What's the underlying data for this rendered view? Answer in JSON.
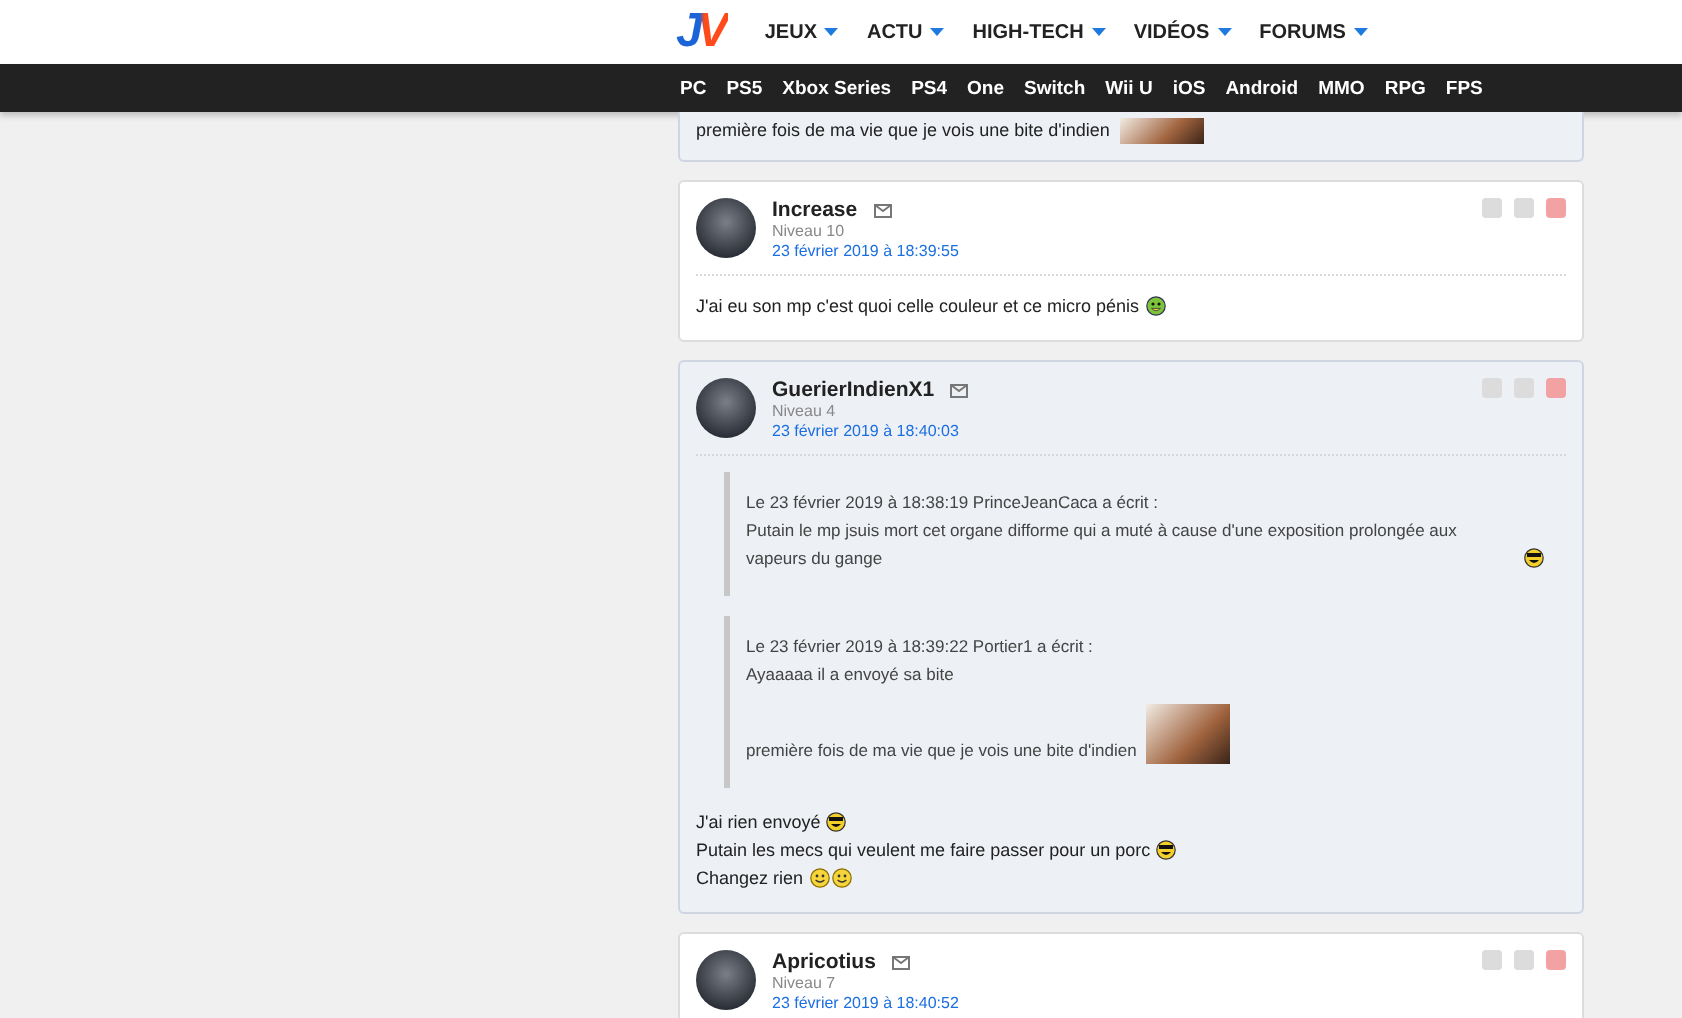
{
  "header": {
    "logo": "JV",
    "menu": [
      {
        "label": "JEUX"
      },
      {
        "label": "ACTU"
      },
      {
        "label": "HIGH-TECH"
      },
      {
        "label": "VIDÉOS"
      },
      {
        "label": "FORUMS"
      }
    ]
  },
  "platforms": [
    "PC",
    "PS5",
    "Xbox Series",
    "PS4",
    "One",
    "Switch",
    "Wii U",
    "iOS",
    "Android",
    "MMO",
    "RPG",
    "FPS"
  ],
  "posts": [
    {
      "highlighted": true,
      "body": [
        {
          "text": "première fois de ma vie que je vois une bite d'indien",
          "photo": true
        }
      ]
    },
    {
      "author": "Increase",
      "level": "Niveau 10",
      "date": "23 février 2019 à 18:39:55",
      "highlighted": false,
      "body": [
        {
          "text": "J'ai eu son mp c'est quoi celle couleur et ce micro pénis",
          "smileys": [
            {
              "kind": "green"
            }
          ]
        }
      ]
    },
    {
      "author": "GuerierIndienX1",
      "level": "Niveau 4",
      "date": "23 février 2019 à 18:40:03",
      "highlighted": true,
      "quotes": [
        {
          "header": "Le 23 février 2019 à 18:38:19 PrinceJeanCaca a écrit :",
          "lines": [
            {
              "text": "Putain le mp jsuis mort cet organe difforme qui a muté à cause d'une exposition prolongée aux vapeurs du gange",
              "smileys": [
                {
                  "kind": "laugh"
                }
              ]
            }
          ]
        },
        {
          "header": "Le 23 février 2019 à 18:39:22 Portier1 a écrit :",
          "lines": [
            {
              "text": "Ayaaaaa il a envoyé sa bite"
            },
            {
              "text": "première fois de ma vie que je vois une bite d'indien",
              "photo": true
            }
          ]
        }
      ],
      "body": [
        {
          "text": "J'ai rien envoyé",
          "smileys": [
            {
              "kind": "laugh"
            }
          ]
        },
        {
          "text": "Putain les mecs qui veulent me faire passer pour un porc",
          "smileys": [
            {
              "kind": "laugh"
            }
          ]
        },
        {
          "text": "Changez rien",
          "smileys": [
            {
              "kind": "smile"
            },
            {
              "kind": "smile"
            }
          ]
        }
      ]
    },
    {
      "author": "Apricotius",
      "level": "Niveau 7",
      "date": "23 février 2019 à 18:40:52",
      "highlighted": false
    }
  ]
}
